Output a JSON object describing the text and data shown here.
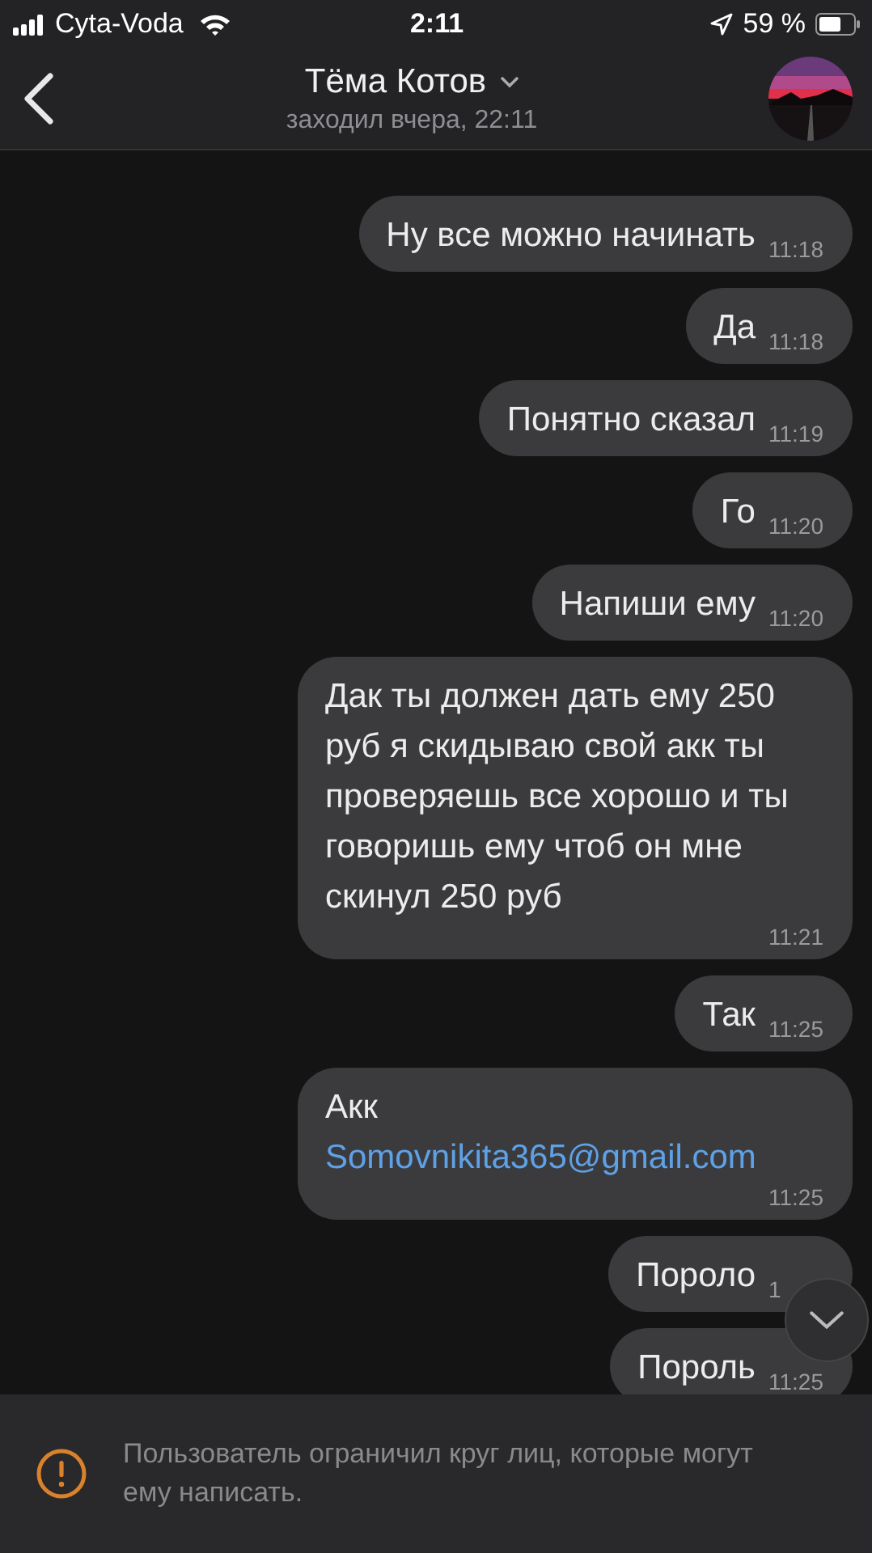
{
  "status_bar": {
    "carrier": "Cyta-Voda",
    "time": "2:11",
    "battery": "59 %"
  },
  "header": {
    "title": "Тёма Котов",
    "subtitle": "заходил вчера, 22:11"
  },
  "messages": [
    {
      "text": "Ну все можно начинать",
      "time": "11:18"
    },
    {
      "text": "Да",
      "time": "11:18"
    },
    {
      "text": "Понятно сказал",
      "time": "11:19"
    },
    {
      "text": "Го",
      "time": "11:20"
    },
    {
      "text": "Напиши ему",
      "time": "11:20"
    },
    {
      "text": "Дак ты должен дать ему 250 руб я скидываю свой акк ты проверяешь все хорошо и ты говоришь ему чтоб он мне скинул 250 руб",
      "time": "11:21"
    },
    {
      "text": "Так",
      "time": "11:25"
    },
    {
      "text": "Акк",
      "link": "Somovnikita365@gmail.com",
      "time": "11:25"
    },
    {
      "text": "Пороло",
      "time": "1"
    },
    {
      "text": "Пороль",
      "time": "11:25"
    }
  ],
  "notice": {
    "text": "Пользователь ограничил круг лиц, которые могут ему написать."
  }
}
